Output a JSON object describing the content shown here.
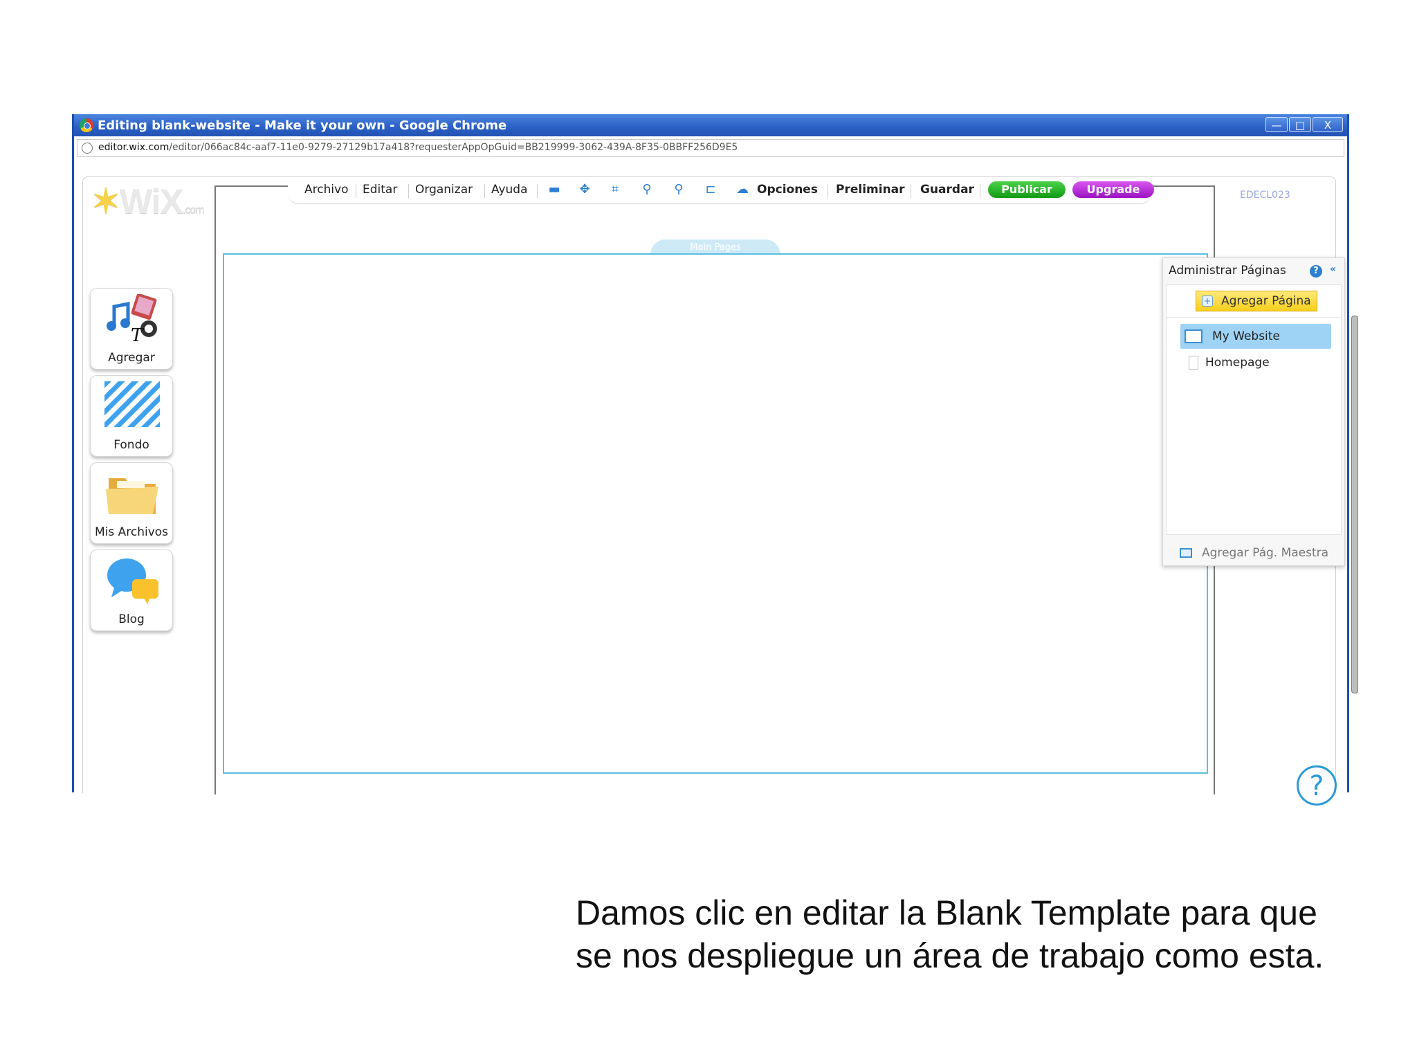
{
  "browser": {
    "title": "Editing blank-website - Make it your own - Google Chrome",
    "controls": {
      "minimize": "—",
      "maximize": "□",
      "close": "X"
    },
    "url_host": "editor.wix.com",
    "url_path": "/editor/066ac84c-aaf7-11e0-9279-27129b17a418?requesterAppOpGuid=BB219999-3062-439A-8F35-0BBFF256D9E5"
  },
  "editor": {
    "logo": {
      "text": "WiX",
      "suffix": ".com"
    },
    "account": "EDECL023",
    "menu": [
      "Archivo",
      "Editar",
      "Organizar",
      "Ayuda"
    ],
    "toolbar_icons": [
      "speech-bubble-icon",
      "move-icon",
      "crop-icon",
      "zoom-out-icon",
      "zoom-in-icon",
      "ruler-icon",
      "settings-icon"
    ],
    "actions": {
      "options": "Opciones",
      "preview": "Preliminar",
      "save": "Guardar",
      "publish": "Publicar",
      "upgrade": "Upgrade"
    },
    "left_tools": [
      {
        "label": "Agregar",
        "icon": "add-media-icon"
      },
      {
        "label": "Fondo",
        "icon": "background-icon"
      },
      {
        "label": "Mis Archivos",
        "icon": "folder-icon"
      },
      {
        "label": "Blog",
        "icon": "chat-bubbles-icon"
      }
    ],
    "canvas_tab": "Main Pages",
    "pages_panel": {
      "title": "Administrar Páginas",
      "help": "?",
      "collapse": "«",
      "add_page": "Agregar Página",
      "site_name": "My Website",
      "pages": [
        "Homepage"
      ],
      "add_master": "Agregar Pág. Maestra"
    },
    "help_bubble": "?"
  },
  "caption": "Damos clic en editar la Blank Template para que se nos despliegue un área de trabajo como esta."
}
